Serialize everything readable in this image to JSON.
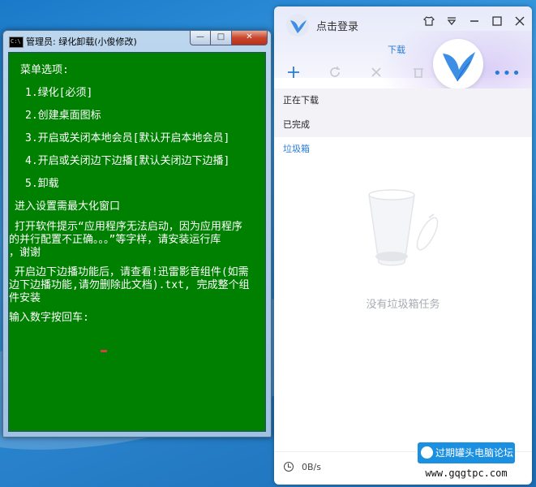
{
  "cmd_window": {
    "title": "管理员: 绿化卸载(小俊修改)",
    "icon_label": "C:\\",
    "buttons": {
      "minimize": "—",
      "maximize": "□",
      "close": "✕"
    },
    "lines": [
      "菜单选项:",
      "1.绿化[必须]",
      "2.创建桌面图标",
      "3.开启或关闭本地会员[默认开启本地会员]",
      "4.开启或关闭边下边播[默认关闭边下边播]",
      "5.卸载",
      "进入设置需最大化窗口",
      "打开软件提示“应用程序无法启动，因为应用程序",
      "的并行配置不正确。。。”等字样，请安装运行库",
      "，谢谢",
      "开启边下边播功能后，请查看!迅雷影音组件(如需",
      "边下边播功能,请勿删除此文档).txt, 完成整个组",
      "件安装",
      "输入数字按回车:"
    ]
  },
  "xunlei": {
    "login_text": "点击登录",
    "controls": [
      "skin-icon",
      "menu-icon",
      "minimize-icon",
      "maximize-icon",
      "close-icon"
    ],
    "download_tab": "下载",
    "toolbar": [
      "add-icon",
      "refresh-icon",
      "delete-icon",
      "trash-icon"
    ],
    "sidebar": [
      {
        "label": "正在下载"
      },
      {
        "label": "已完成"
      },
      {
        "label": "垃圾箱"
      }
    ],
    "empty_text": "没有垃圾箱任务",
    "speed": "0B/s",
    "accent": "#2a7bd5"
  },
  "watermark": {
    "title": "过期罐头电脑论坛",
    "url": "www.gqgtpc.com"
  }
}
